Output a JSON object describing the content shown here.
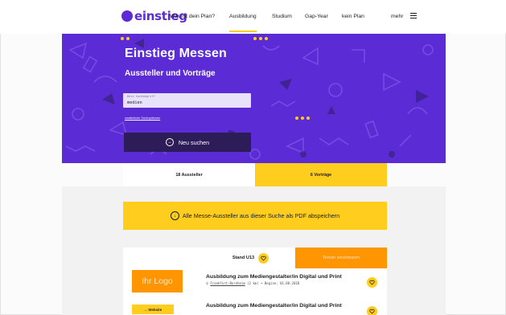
{
  "brand": {
    "logo_text": "einstieg",
    "color": "#5b2bd6",
    "accent": "#ffcd1e",
    "orange": "#ff9500"
  },
  "nav": {
    "items": [
      {
        "label": "Was ist dein Plan?"
      },
      {
        "label": "Ausbildung",
        "active": true
      },
      {
        "label": "Studium"
      },
      {
        "label": "Gap-Year"
      },
      {
        "label": "kein Plan"
      }
    ],
    "more_label": "mehr",
    "menu_icon": "hamburger-icon"
  },
  "hero": {
    "title": "Einstieg Messen",
    "subtitle": "Aussteller und Vorträge",
    "search_label": "Dein Suchbegriff",
    "search_value": "medien",
    "more_options": "zusätzliche Suchoptionen",
    "search_button": "Neu suchen"
  },
  "tabs": {
    "exhibitors": "18 Aussteller",
    "talks": "6 Vorträge"
  },
  "pdf_banner": {
    "label": "Alle Messe-Aussteller aus dieser Suche als PDF abspeichern",
    "icon": "download-icon"
  },
  "card": {
    "stand": "Stand U13",
    "appointment": "Termin vereinbaren",
    "logo_placeholder": "Ihr Logo",
    "website": "→ Website",
    "jobs": [
      {
        "title": "Ausbildung zum Mediengestalter/in Digital und Print",
        "location": "Frankfurt-Bornheim",
        "details": "(2 km) • Beginn: 01.08.2018"
      },
      {
        "title": "Ausbildung zum Mediengestalter/in Digital und Print",
        "location": "",
        "details": ""
      }
    ]
  }
}
